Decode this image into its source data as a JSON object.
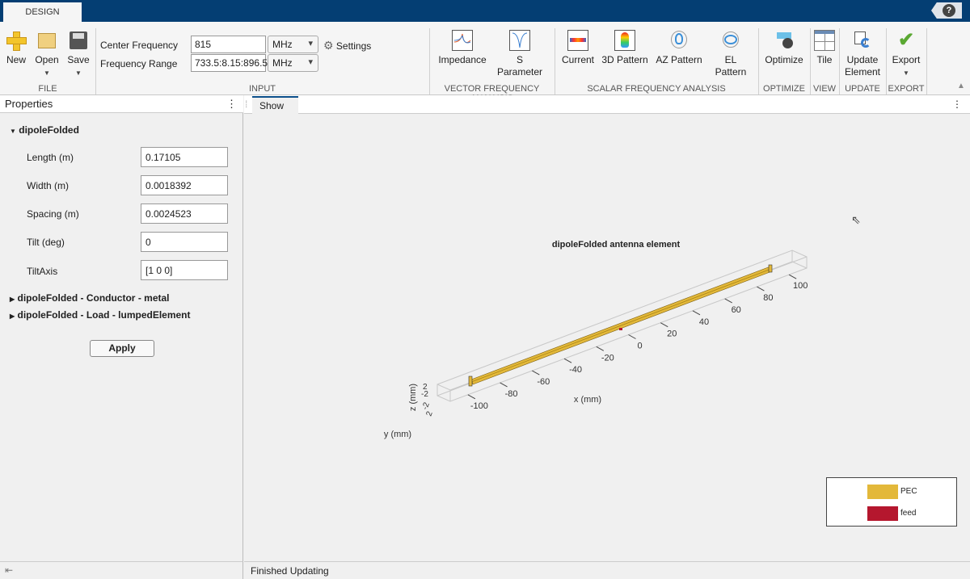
{
  "window": {
    "tab": "DESIGN",
    "help": "?"
  },
  "ribbon": {
    "file": {
      "group": "FILE",
      "new": "New",
      "open": "Open",
      "save": "Save"
    },
    "input": {
      "group": "INPUT",
      "center_frequency_label": "Center Frequency",
      "center_frequency": "815",
      "center_unit": "MHz",
      "frequency_range_label": "Frequency Range",
      "frequency_range": "733.5:8.15:896.5",
      "range_unit": "MHz",
      "settings": "Settings"
    },
    "vector": {
      "group": "VECTOR FREQUENCY ANALYSIS",
      "impedance": "Impedance",
      "sparam": "S Parameter"
    },
    "scalar": {
      "group": "SCALAR FREQUENCY ANALYSIS",
      "current": "Current",
      "pattern3d": "3D Pattern",
      "az": "AZ Pattern",
      "el": "EL Pattern"
    },
    "optimize": {
      "group": "OPTIMIZE",
      "label": "Optimize"
    },
    "view": {
      "group": "VIEW",
      "label": "Tile"
    },
    "update": {
      "group": "UPDATE",
      "label1": "Update",
      "label2": "Element"
    },
    "export": {
      "group": "EXPORT",
      "label": "Export"
    }
  },
  "properties": {
    "title": "Properties",
    "node": "dipoleFolded",
    "fields": [
      {
        "label": "Length (m)",
        "value": "0.17105"
      },
      {
        "label": "Width (m)",
        "value": "0.0018392"
      },
      {
        "label": "Spacing (m)",
        "value": "0.0024523"
      },
      {
        "label": "Tilt (deg)",
        "value": "0"
      },
      {
        "label": "TiltAxis",
        "value": "[1 0 0]"
      }
    ],
    "conductor": "dipoleFolded - Conductor - metal",
    "load": "dipoleFolded - Load - lumpedElement",
    "apply": "Apply"
  },
  "document": {
    "tab": "Show",
    "status": "Finished Updating"
  },
  "plot": {
    "title": "dipoleFolded antenna element",
    "xlabel": "x (mm)",
    "ylabel": "y (mm)",
    "zlabel": "z (mm)",
    "xticks": [
      "-100",
      "-80",
      "-60",
      "-40",
      "-20",
      "0",
      "20",
      "40",
      "60",
      "80",
      "100"
    ],
    "zticks": [
      "2",
      "-2"
    ],
    "yticks": [
      "-2",
      "2"
    ],
    "legend": [
      {
        "name": "PEC",
        "color": "#e3b83a"
      },
      {
        "name": "feed",
        "color": "#b5172e"
      }
    ]
  }
}
